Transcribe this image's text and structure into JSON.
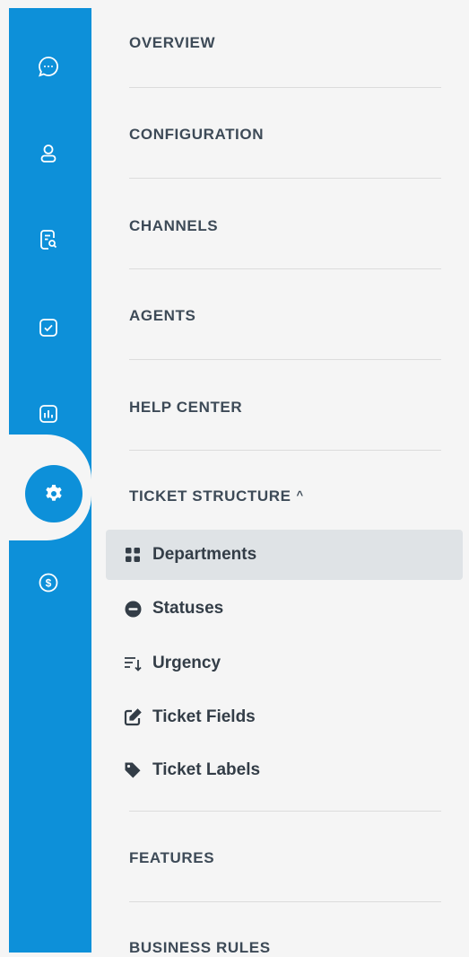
{
  "rail": {
    "items": [
      {
        "icon": "chat-icon"
      },
      {
        "icon": "user-icon"
      },
      {
        "icon": "search-document-icon"
      },
      {
        "icon": "checkbox-icon"
      },
      {
        "icon": "bar-chart-icon"
      },
      {
        "icon": "gear-icon",
        "active": true
      },
      {
        "icon": "dollar-circle-icon"
      }
    ],
    "accent": "#0d90d9"
  },
  "nav": {
    "sections": {
      "overview": "OVERVIEW",
      "configuration": "CONFIGURATION",
      "channels": "CHANNELS",
      "agents": "AGENTS",
      "help_center": "HELP CENTER",
      "ticket_structure": "TICKET STRUCTURE",
      "ticket_structure_caret": "^",
      "features": "FEATURES",
      "business_rules": "BUSINESS RULES"
    },
    "ticket_structure_items": {
      "departments": "Departments",
      "statuses": "Statuses",
      "urgency": "Urgency",
      "ticket_fields": "Ticket Fields",
      "ticket_labels": "Ticket Labels"
    },
    "active_item": "Departments"
  }
}
